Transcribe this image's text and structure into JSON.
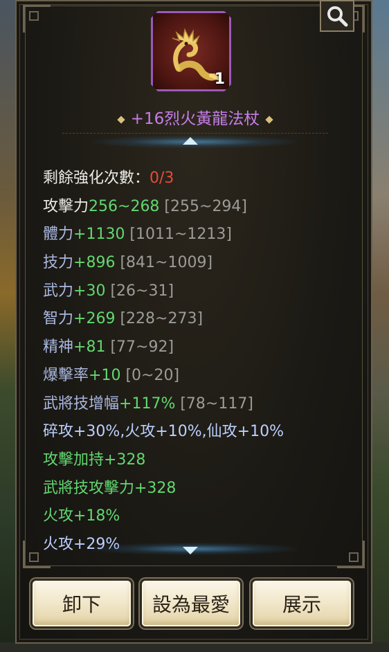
{
  "item": {
    "title": "+16烈火黃龍法杖",
    "count": "1",
    "icon": "golden-dragon-staff-icon"
  },
  "stats": [
    {
      "label": "剩餘強化次數：",
      "value": "0/3",
      "range": "",
      "label_color": "white",
      "value_color": "red"
    },
    {
      "label": "攻擊力",
      "value": "256~268",
      "range": " [255~294]",
      "label_color": "white",
      "value_color": "green"
    },
    {
      "label": "體力",
      "value": "+1130",
      "range": " [1011~1213]",
      "label_color": "blue",
      "value_color": "green"
    },
    {
      "label": "技力",
      "value": "+896",
      "range": " [841~1009]",
      "label_color": "blue",
      "value_color": "green"
    },
    {
      "label": "武力",
      "value": "+30",
      "range": " [26~31]",
      "label_color": "blue",
      "value_color": "green"
    },
    {
      "label": "智力",
      "value": "+269",
      "range": " [228~273]",
      "label_color": "blue",
      "value_color": "green"
    },
    {
      "label": "精神",
      "value": "+81",
      "range": " [77~92]",
      "label_color": "blue",
      "value_color": "green"
    },
    {
      "label": "爆擊率",
      "value": "+10",
      "range": " [0~20]",
      "label_color": "blue",
      "value_color": "green"
    },
    {
      "label": "武將技增幅",
      "value": "+117%",
      "range": " [78~117]",
      "label_color": "blue",
      "value_color": "green"
    },
    {
      "label": "碎攻+30%,火攻+10%,仙攻+10%",
      "value": "",
      "range": "",
      "label_color": "lightblue",
      "value_color": "green"
    },
    {
      "label": "攻擊加持+328",
      "value": "",
      "range": "",
      "label_color": "green",
      "value_color": "green"
    },
    {
      "label": "武將技攻擊力+328",
      "value": "",
      "range": "",
      "label_color": "green",
      "value_color": "green"
    },
    {
      "label": "火攻+18%",
      "value": "",
      "range": "",
      "label_color": "green",
      "value_color": "green"
    },
    {
      "label": "火攻+29%",
      "value": "",
      "range": "",
      "label_color": "lightblue",
      "value_color": "green"
    }
  ],
  "buttons": {
    "unequip": "卸下",
    "favorite": "設為最愛",
    "show": "展示"
  },
  "icons": {
    "zoom": "magnifier-icon",
    "scroll_up": "arrow-up-icon",
    "scroll_down": "arrow-down-icon"
  },
  "colors": {
    "title": "#c67ee8",
    "green_value": "#62d870",
    "red_value": "#e84a3a",
    "range_gray": "#9c9c98"
  }
}
